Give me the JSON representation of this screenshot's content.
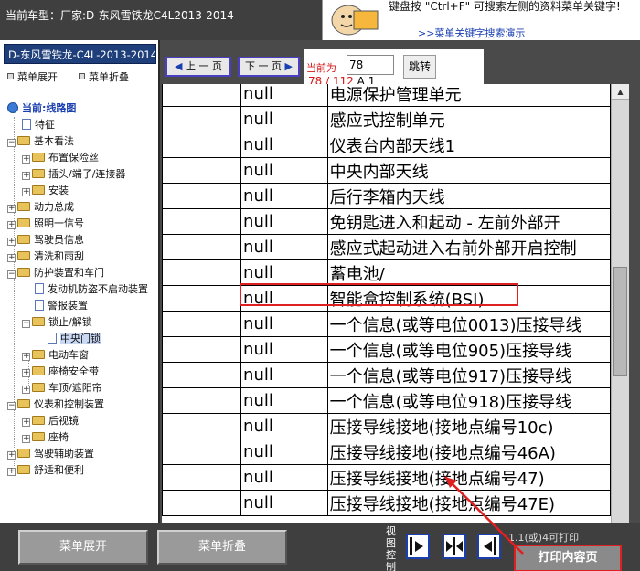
{
  "header": {
    "title": "当前车型：厂家:D-东风雪铁龙C4L2013-2014",
    "help_text": "键盘按 \"Ctrl+F\" 可搜索左侧的资料菜单关键字!",
    "help_link": ">>菜单关键字搜索演示"
  },
  "left_panel": {
    "vehicle_tab": "D-东风雪铁龙-C4L-2013-2014",
    "expand_menu": "菜单展开",
    "collapse_menu": "菜单折叠",
    "tree": [
      {
        "label": "当前:线路图",
        "icon": "globe-icon"
      },
      {
        "label": "特征",
        "icon": "page-icon"
      },
      {
        "label": "基本看法",
        "icon": "folder-icon"
      },
      {
        "label": "布置保险丝",
        "icon": "folder-icon"
      },
      {
        "label": "插头/端子/连接器",
        "icon": "folder-icon"
      },
      {
        "label": "安装",
        "icon": "folder-icon"
      },
      {
        "label": "动力总成",
        "icon": "folder-icon"
      },
      {
        "label": "照明一信号",
        "icon": "folder-icon"
      },
      {
        "label": "驾驶员信息",
        "icon": "folder-icon"
      },
      {
        "label": "清洗和雨刮",
        "icon": "folder-icon"
      },
      {
        "label": "防护装置和车门",
        "icon": "folder-icon"
      },
      {
        "label": "发动机防盗不启动装置",
        "icon": "page-icon"
      },
      {
        "label": "警报装置",
        "icon": "page-icon"
      },
      {
        "label": "锁止/解锁",
        "icon": "folder-icon"
      },
      {
        "label": "中央门锁",
        "icon": "page-icon"
      },
      {
        "label": "电动车窗",
        "icon": "folder-icon"
      },
      {
        "label": "座椅安全带",
        "icon": "folder-icon"
      },
      {
        "label": "车顶/遮阳帘",
        "icon": "folder-icon"
      },
      {
        "label": "仪表和控制装置",
        "icon": "folder-icon"
      },
      {
        "label": "后视镜",
        "icon": "folder-icon"
      },
      {
        "label": "座椅",
        "icon": "folder-icon"
      },
      {
        "label": "驾驶辅助装置",
        "icon": "folder-icon"
      },
      {
        "label": "舒适和便利",
        "icon": "folder-icon"
      }
    ]
  },
  "nav": {
    "prev_label": "上 一 页",
    "next_label": "下 一 页",
    "current_label": "当前为",
    "page_value": "78",
    "jump_label": "跳转",
    "current_page": "78",
    "separator": " / ",
    "total_pages": "112",
    "suffix": " A 1"
  },
  "document": {
    "rows": [
      {
        "c2": "null",
        "c3": "电源保护管理单元"
      },
      {
        "c2": "null",
        "c3": "感应式控制单元"
      },
      {
        "c2": "null",
        "c3": "仪表台内部天线1"
      },
      {
        "c2": "null",
        "c3": "中央内部天线"
      },
      {
        "c2": "null",
        "c3": "后行李箱内天线"
      },
      {
        "c2": "null",
        "c3": "免钥匙进入和起动 - 左前外部开"
      },
      {
        "c2": "null",
        "c3": "感应式起动进入右前外部开启控制"
      },
      {
        "c2": "null",
        "c3": "蓄电池/"
      },
      {
        "c2": "null",
        "c3": "智能盒控制系统(BSI)"
      },
      {
        "c2": "null",
        "c3": "一个信息(或等电位0013)压接导线"
      },
      {
        "c2": "null",
        "c3": "一个信息(或等电位905)压接导线"
      },
      {
        "c2": "null",
        "c3": "一个信息(或等电位917)压接导线"
      },
      {
        "c2": "null",
        "c3": "一个信息(或等电位918)压接导线"
      },
      {
        "c2": "null",
        "c3": "压接导线接地(接地点编号10c)"
      },
      {
        "c2": "null",
        "c3": "压接导线接地(接地点编号46A)"
      },
      {
        "c2": "null",
        "c3": "压接导线接地(接地点编号47)"
      },
      {
        "c2": "null",
        "c3": "压接导线接地(接地点编号47E)"
      }
    ]
  },
  "bottom": {
    "expand_button": "菜单展开",
    "collapse_button": "菜单折叠",
    "view_control_label": "视图控制",
    "print_info": "1.1(或)4可打印",
    "print_button": "打印内容页"
  },
  "colors": {
    "accent_red": "#e02020",
    "nav_border": "#4a3fc0",
    "vehicle_tab": "#1f3f7a"
  }
}
